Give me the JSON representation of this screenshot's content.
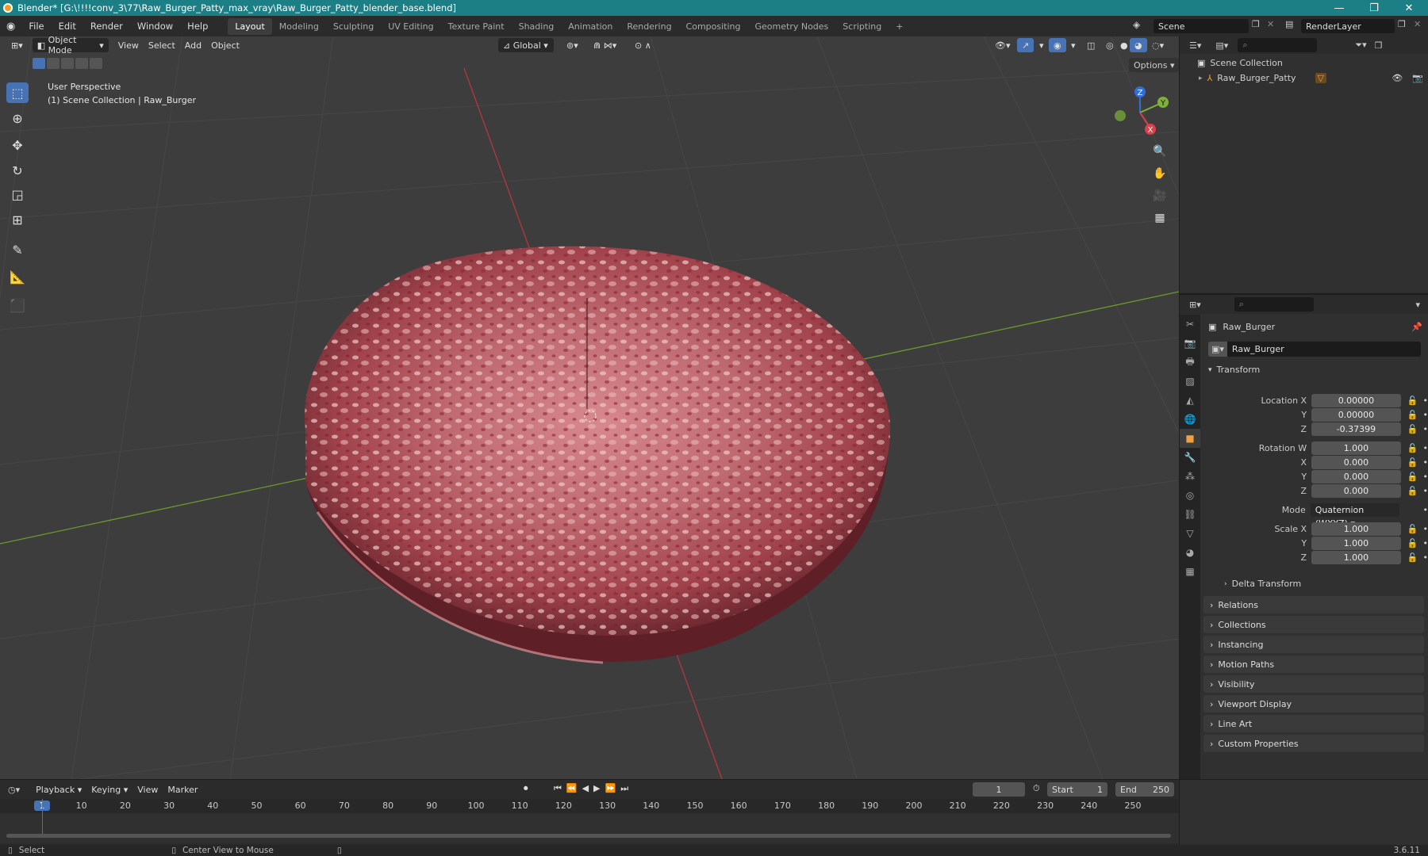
{
  "window": {
    "title": "Blender* [G:\\!!!!conv_3\\77\\Raw_Burger_Patty_max_vray\\Raw_Burger_Patty_blender_base.blend]",
    "minimize": "—",
    "maximize": "❐",
    "close": "✕"
  },
  "menu": [
    "File",
    "Edit",
    "Render",
    "Window",
    "Help"
  ],
  "workspaces": [
    "Layout",
    "Modeling",
    "Sculpting",
    "UV Editing",
    "Texture Paint",
    "Shading",
    "Animation",
    "Rendering",
    "Compositing",
    "Geometry Nodes",
    "Scripting",
    "+"
  ],
  "active_workspace": "Layout",
  "scene": {
    "label": "Scene",
    "view_layer": "RenderLayer"
  },
  "viewport": {
    "mode": "Object Mode",
    "menus": [
      "View",
      "Select",
      "Add",
      "Object"
    ],
    "transform_orientation": "Global",
    "options": "Options",
    "overlay_line1": "User Perspective",
    "overlay_line2": "(1) Scene Collection | Raw_Burger",
    "gizmo": {
      "z": "Z",
      "y": "Y",
      "x": "X"
    }
  },
  "outliner": {
    "root": "Scene Collection",
    "items": [
      {
        "label": "Raw_Burger_Patty"
      }
    ]
  },
  "properties": {
    "object_name": "Raw_Burger",
    "datablock": "Raw_Burger",
    "transform_header": "Transform",
    "location_label": "Location X",
    "location": {
      "x": "0.00000",
      "y": "0.00000",
      "z": "-0.37399"
    },
    "rotation_label": "Rotation W",
    "rotation": {
      "w": "1.000",
      "x": "0.000",
      "y": "0.000",
      "z": "0.000"
    },
    "mode_label": "Mode",
    "mode": "Quaternion (WXYZ)",
    "scale_label": "Scale X",
    "scale": {
      "x": "1.000",
      "y": "1.000",
      "z": "1.000"
    },
    "axis_y": "Y",
    "axis_z": "Z",
    "axis_x": "X",
    "delta": "Delta Transform",
    "panels": [
      "Relations",
      "Collections",
      "Instancing",
      "Motion Paths",
      "Visibility",
      "Viewport Display",
      "Line Art",
      "Custom Properties"
    ]
  },
  "timeline": {
    "menus": [
      "Playback",
      "Keying",
      "View",
      "Marker"
    ],
    "current_frame": "1",
    "start_label": "Start",
    "start": "1",
    "end_label": "End",
    "end": "250",
    "ticks": [
      "1",
      "10",
      "20",
      "30",
      "40",
      "50",
      "60",
      "70",
      "80",
      "90",
      "100",
      "110",
      "120",
      "130",
      "140",
      "150",
      "160",
      "170",
      "180",
      "190",
      "200",
      "210",
      "220",
      "230",
      "240",
      "250"
    ]
  },
  "status": {
    "left": "Select",
    "middle": "Center View to Mouse",
    "version": "3.6.11"
  },
  "colors": {
    "accent": "#4772b3",
    "titlebar": "#1d7f86",
    "x_axis": "#c0392b",
    "y_axis": "#6c9a2b"
  }
}
